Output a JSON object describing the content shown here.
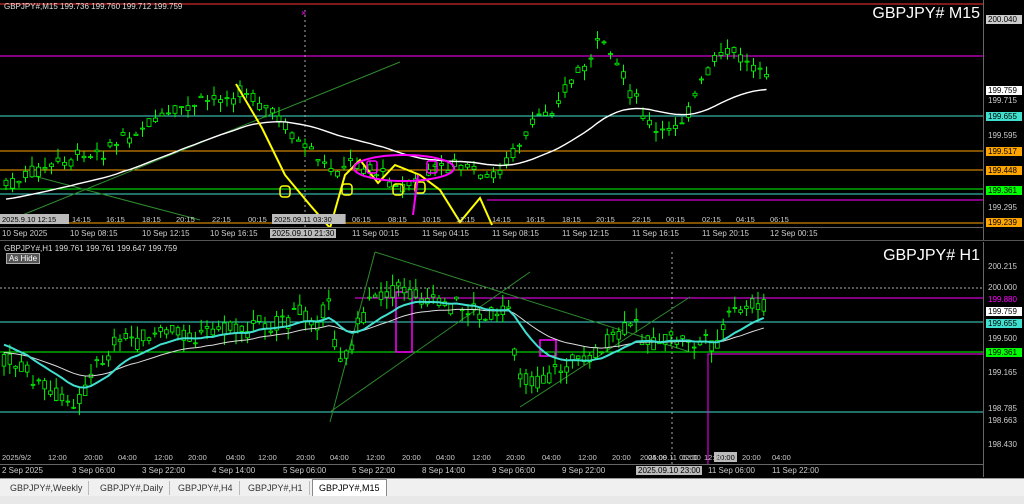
{
  "pane_top": {
    "header": "GBPJPY#,M15  199.736 199.760 199.712 199.759",
    "title": "GBPJPY# M15",
    "price_labels": [
      {
        "text": "200.040",
        "color": "#000",
        "bg": "#cccccc"
      },
      {
        "text": "199.759",
        "color": "#000",
        "bg": "#ffffff"
      },
      {
        "text": "199.715",
        "color": "#cccccc",
        "bg": ""
      },
      {
        "text": "199.655",
        "color": "#000",
        "bg": "#40e0d0"
      },
      {
        "text": "199.595",
        "color": "#cccccc",
        "bg": ""
      },
      {
        "text": "199.517",
        "color": "#000",
        "bg": "#ffa500"
      },
      {
        "text": "199.448",
        "color": "#000",
        "bg": "#ffa500"
      },
      {
        "text": "199.361",
        "color": "#000",
        "bg": "#00ff00"
      },
      {
        "text": "199.295",
        "color": "#cccccc",
        "bg": ""
      },
      {
        "text": "199.239",
        "color": "#000",
        "bg": "#ffa500"
      }
    ],
    "time_labels": [
      "10 Sep 2025",
      "10 Sep 08:15",
      "10 Sep 12:15",
      "10 Sep 16:15",
      "2025.09.10 21:30",
      "11 Sep 00:15",
      "11 Sep 04:15",
      "11 Sep 08:15",
      "11 Sep 12:15",
      "11 Sep 16:15",
      "11 Sep 20:15",
      "12 Sep 00:15"
    ],
    "inner_time_labels": [
      "2025.9.10 12:15",
      "14:15",
      "16:15",
      "18:15",
      "20:15",
      "22:15",
      "00:15",
      "2025.09.11 03:30",
      "06:15",
      "08:15",
      "10:15",
      "12:15",
      "14:15",
      "16:15",
      "18:15",
      "20:15",
      "22:15",
      "00:15",
      "02:15",
      "04:15",
      "06:15"
    ]
  },
  "pane_bottom": {
    "header": "GBPJPY#,H1  199.761 199.761 199.647 199.759",
    "title": "GBPJPY# H1",
    "ashide_label": "As Hide",
    "price_labels": [
      {
        "text": "200.215",
        "color": "#cccccc",
        "bg": ""
      },
      {
        "text": "200.000",
        "color": "#cccccc",
        "bg": ""
      },
      {
        "text": "199.880",
        "color": "#ff00ff",
        "bg": "#000"
      },
      {
        "text": "199.759",
        "color": "#000",
        "bg": "#ffffff"
      },
      {
        "text": "199.655",
        "color": "#000",
        "bg": "#40e0d0"
      },
      {
        "text": "199.500",
        "color": "#cccccc",
        "bg": ""
      },
      {
        "text": "199.361",
        "color": "#000",
        "bg": "#00ff00"
      },
      {
        "text": "199.165",
        "color": "#cccccc",
        "bg": ""
      },
      {
        "text": "198.785",
        "color": "#cccccc",
        "bg": ""
      },
      {
        "text": "198.663",
        "color": "#cccccc",
        "bg": ""
      },
      {
        "text": "198.430",
        "color": "#cccccc",
        "bg": ""
      }
    ],
    "time_labels": [
      "2 Sep 2025",
      "3 Sep 06:00",
      "3 Sep 22:00",
      "4 Sep 14:00",
      "5 Sep 06:00",
      "5 Sep 22:00",
      "8 Sep 14:00",
      "9 Sep 06:00",
      "9 Sep 22:00",
      "2025.09.10 23:00",
      "11 Sep 06:00",
      "11 Sep 22:00"
    ],
    "inner_time_labels": [
      "2025/9/2",
      "12:00",
      "20:00",
      "04:00",
      "12:00",
      "20:00",
      "04:00",
      "12:00",
      "20:00",
      "04:00",
      "12:00",
      "20:00",
      "04:00",
      "12:00",
      "20:00",
      "04:00",
      "12:00",
      "20:00",
      "04:00",
      "12:00",
      "20:00",
      "2025.09.11 05:00",
      "12:00",
      "20:00",
      "04:00"
    ]
  },
  "tabs": [
    "GBPJPY#,Weekly",
    "GBPJPY#,Daily",
    "GBPJPY#,H4",
    "GBPJPY#,H1",
    "GBPJPY#,M15"
  ],
  "active_tab": "GBPJPY#,M15",
  "colors": {
    "candle": "#00ff00",
    "ma_white": "#ffffff",
    "ma_cyan": "#40e0d0",
    "draw_yellow": "#ffff00",
    "draw_magenta": "#ff00ff",
    "resistance": "#ff00ff",
    "support": "#00ff00",
    "level_orange": "#ffa500"
  }
}
